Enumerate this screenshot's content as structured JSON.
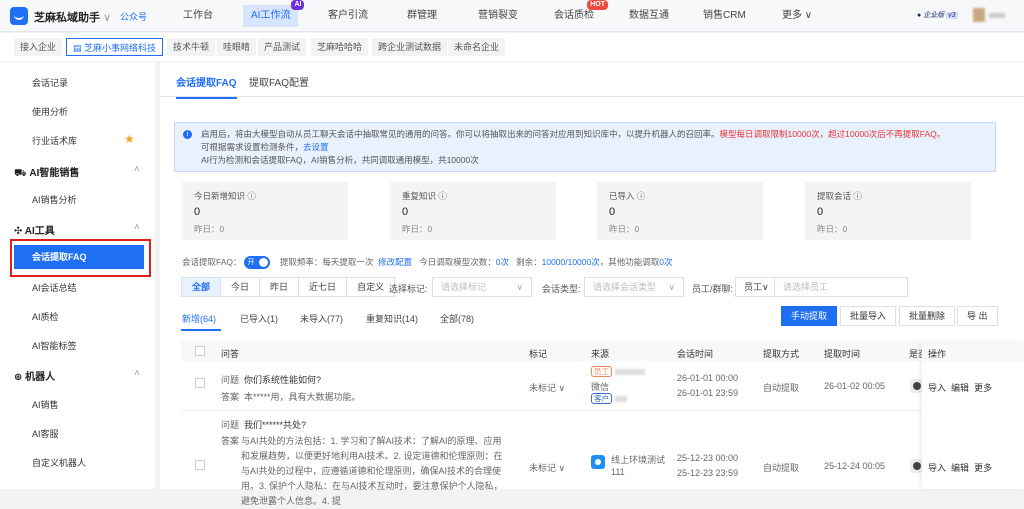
{
  "header": {
    "brand": "芝麻私域助手",
    "account_link": "公众号",
    "nav": [
      {
        "label": "工作台"
      },
      {
        "label": "AI工作流",
        "badge": "AI"
      },
      {
        "label": "客户引流"
      },
      {
        "label": "群管理"
      },
      {
        "label": "营销裂变"
      },
      {
        "label": "会话质检",
        "badge": "HOT"
      },
      {
        "label": "数据互通"
      },
      {
        "label": "销售CRM"
      },
      {
        "label": "更多 ∨"
      }
    ],
    "edition": "企业版",
    "version": "v3"
  },
  "companies": [
    "接入企业",
    "芝麻小事网络科技",
    "技术牛顿",
    "哇眼睛",
    "产品测试",
    "芝麻哈哈哈",
    "跨企业测试数据",
    "未命名企业"
  ],
  "sidebar": {
    "items": [
      "会话记录",
      "使用分析",
      "行业话术库"
    ],
    "ai_sales": {
      "title": "AI智能销售",
      "items": [
        "AI销售分析"
      ]
    },
    "ai_tools": {
      "title": "AI工具",
      "items": [
        "会话提取FAQ",
        "AI会话总结",
        "AI质检",
        "AI智能标签"
      ]
    },
    "robot": {
      "title": "机器人",
      "items": [
        "AI销售",
        "AI客服",
        "自定义机器人"
      ]
    }
  },
  "tabs": [
    "会话提取FAQ",
    "提取FAQ配置"
  ],
  "alert": {
    "p1": "启用后，将由大模型自动从员工聊天会话中抽取常见的通用的问答。你可以将抽取出来的问答对应用到知识库中，以提升机器人的召回率。",
    "p1_red": "模型每日调取限制10000次，超过10000次后不再提取FAQ。",
    "p2": "可根据需求设置检测条件，",
    "p2_link": "去设置",
    "p3": "AI行为检测和会话提取FAQ，AI销售分析，共同调取通用模型，共10000次"
  },
  "stats": [
    {
      "label": "今日新增知识 ⓘ",
      "value": "0",
      "yesterday": "昨日：0"
    },
    {
      "label": "重复知识 ⓘ",
      "value": "0",
      "yesterday": "昨日：0"
    },
    {
      "label": "已导入 ⓘ",
      "value": "0",
      "yesterday": "昨日：0"
    },
    {
      "label": "提取会话 ⓘ",
      "value": "0",
      "yesterday": "昨日：0"
    }
  ],
  "settings": {
    "label": "会话提取FAQ：",
    "toggle": "开",
    "freq": "提取频率：每天提取一次",
    "modify": "修改配置",
    "today_label": "今日调取模型次数：",
    "today": "0次",
    "remain_label": "剩余：",
    "remain": "10000/10000次",
    "other_label": "，其他功能调取",
    "other": "0次"
  },
  "filters": {
    "range": [
      "全部",
      "今日",
      "昨日",
      "近七日",
      "自定义"
    ],
    "mark_label": "选择标记:",
    "mark_ph": "请选择标记",
    "type_label": "会话类型:",
    "type_ph": "请选择会话类型",
    "staff_label": "员工/群聊:",
    "staff_sel": "员工∨",
    "staff_ph": "请选择员工"
  },
  "subtabs": [
    "新增(64)",
    "已导入(1)",
    "未导入(77)",
    "重复知识(14)",
    "全部(78)"
  ],
  "actions": [
    "手动提取",
    "批量导入",
    "批量删除",
    "导 出"
  ],
  "table": {
    "headers": [
      "问答",
      "标记",
      "来源",
      "会话时间",
      "提取方式",
      "提取时间",
      "是否",
      "操作"
    ],
    "rows": [
      {
        "q_label": "问题",
        "q": "你们系统性能如何?",
        "a_label": "答案",
        "a": "本*****用，具有大数据功能。",
        "mark": "未标记 ∨",
        "tag1": "员工",
        "src": "微信",
        "tag2": "客户",
        "t1": "26-01-01 00:00",
        "t2": "26-01-01 23:59",
        "method": "自动提取",
        "time": "26-01-02 00:05",
        "ops": [
          "导入",
          "编辑",
          "更多"
        ]
      },
      {
        "q_label": "问题",
        "q": "我们******共处?",
        "a_label": "答案",
        "a": "与AI共处的方法包括：1. 学习和了解AI技术：了解AI的原理、应用和发展趋势，以便更好地利用AI技术。2. 设定道德和伦理原则：在与AI共处的过程中，应遵循道德和伦理原则，确保AI技术的合理使用。3. 保护个人隐私：在与AI技术互动时，要注意保护个人隐私，避免泄露个人信息。4. 提",
        "mark": "未标记 ∨",
        "src": "线上环境测试",
        "src2": "111",
        "t1": "25-12-23 00:00",
        "t2": "25-12-23 23:59",
        "method": "自动提取",
        "time": "25-12-24 00:05",
        "ops": [
          "导入",
          "编辑",
          "更多"
        ]
      }
    ]
  }
}
